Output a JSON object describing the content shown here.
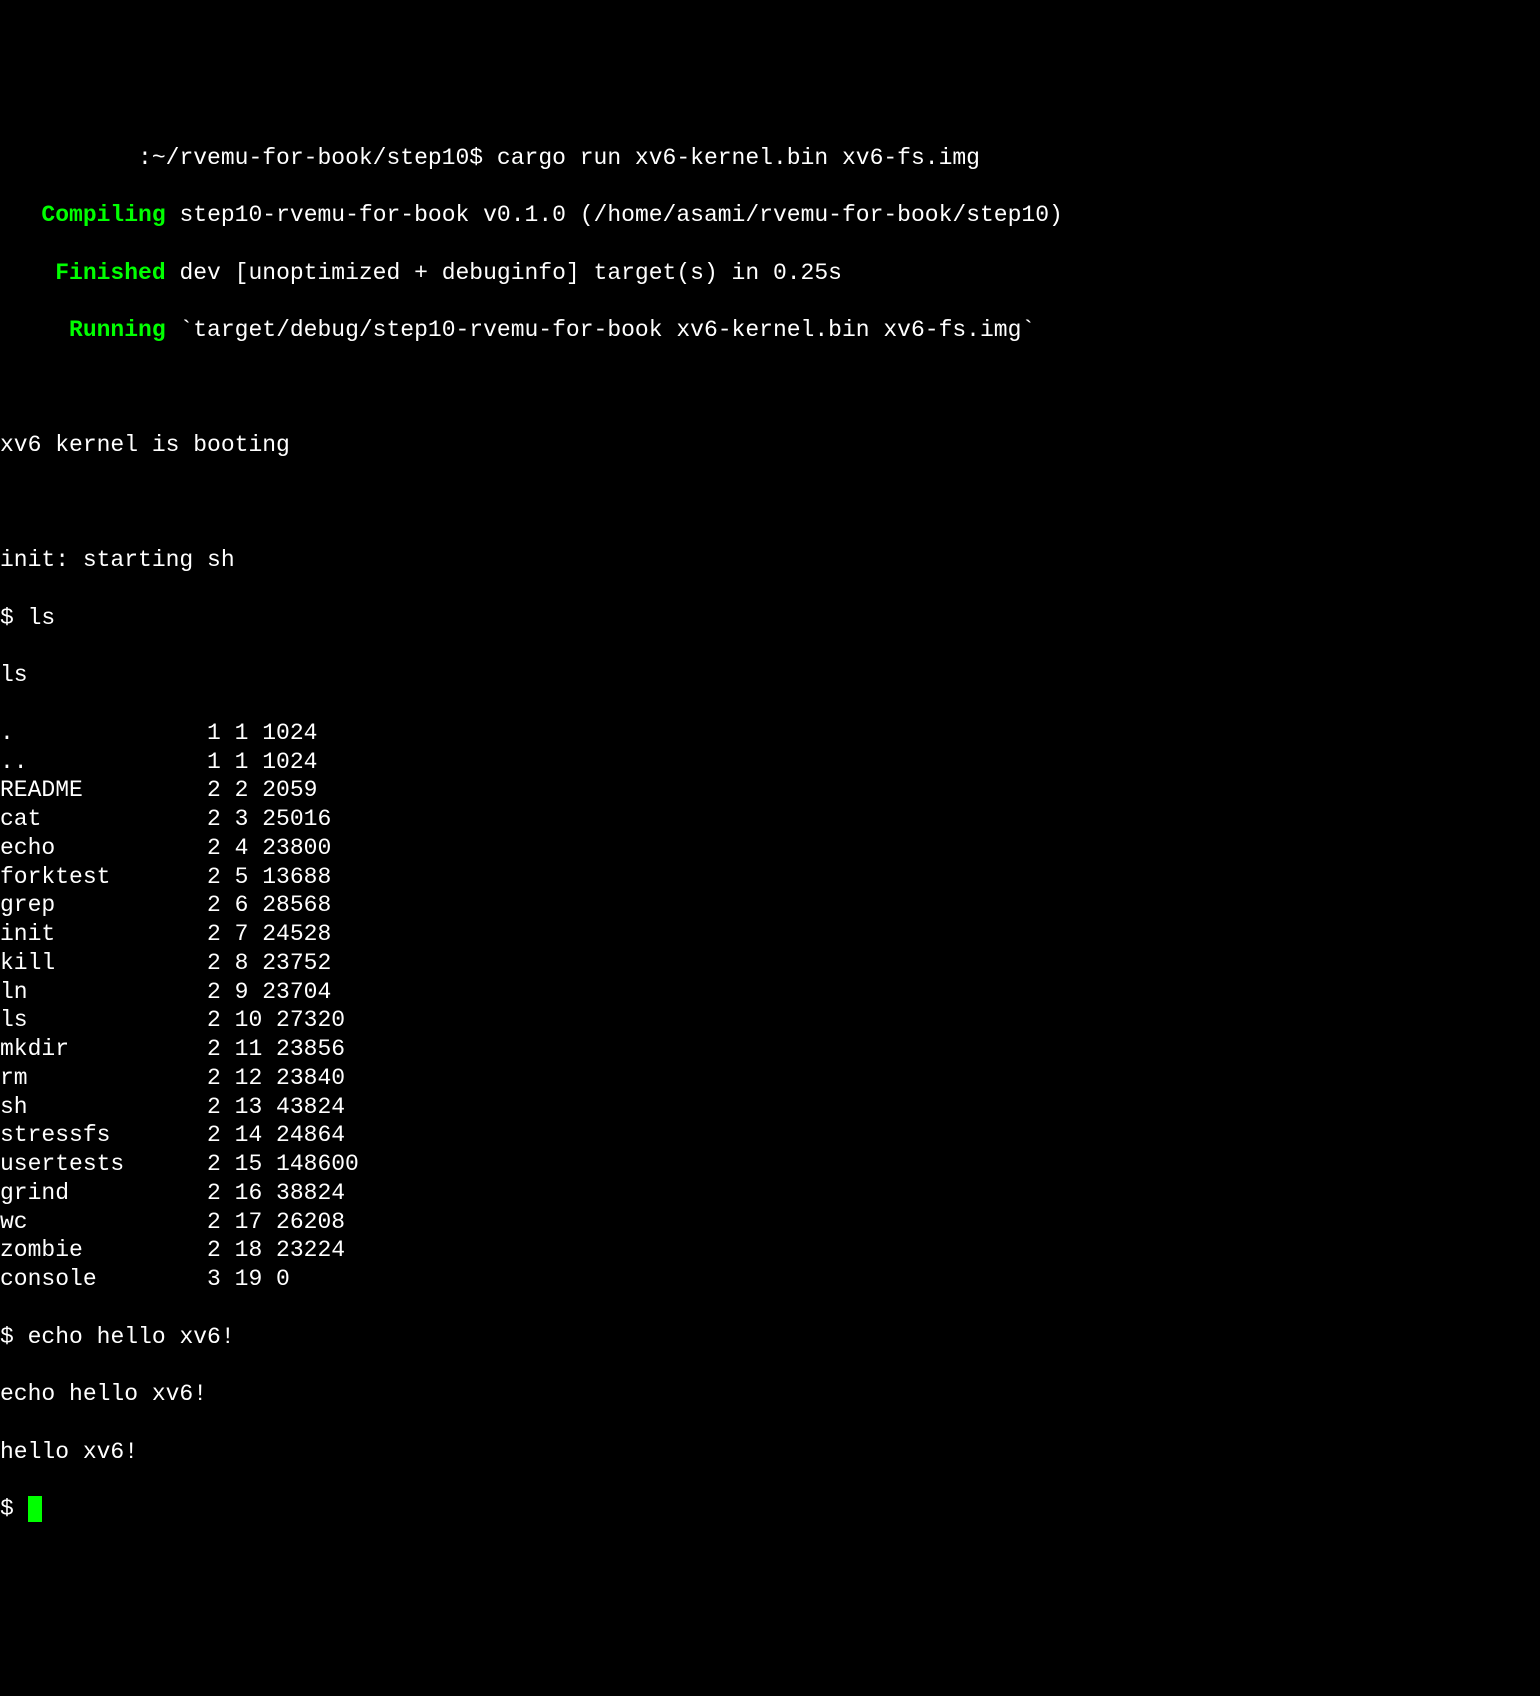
{
  "prompt_path": ":~/rvemu-for-book/step10$",
  "prompt_command": "cargo run xv6-kernel.bin xv6-fs.img",
  "compiling_label": "Compiling",
  "compiling_text": "step10-rvemu-for-book v0.1.0 (/home/asami/rvemu-for-book/step10)",
  "finished_label": "Finished",
  "finished_text": "dev [unoptimized + debuginfo] target(s) in 0.25s",
  "running_label": "Running",
  "running_text": "`target/debug/step10-rvemu-for-book xv6-kernel.bin xv6-fs.img`",
  "boot_message": "xv6 kernel is booting",
  "init_message": "init: starting sh",
  "shell_prompt": "$",
  "ls_command": "ls",
  "ls_echo": "ls",
  "files": [
    {
      "name": ".",
      "type": "1",
      "inode": "1",
      "size": "1024"
    },
    {
      "name": "..",
      "type": "1",
      "inode": "1",
      "size": "1024"
    },
    {
      "name": "README",
      "type": "2",
      "inode": "2",
      "size": "2059"
    },
    {
      "name": "cat",
      "type": "2",
      "inode": "3",
      "size": "25016"
    },
    {
      "name": "echo",
      "type": "2",
      "inode": "4",
      "size": "23800"
    },
    {
      "name": "forktest",
      "type": "2",
      "inode": "5",
      "size": "13688"
    },
    {
      "name": "grep",
      "type": "2",
      "inode": "6",
      "size": "28568"
    },
    {
      "name": "init",
      "type": "2",
      "inode": "7",
      "size": "24528"
    },
    {
      "name": "kill",
      "type": "2",
      "inode": "8",
      "size": "23752"
    },
    {
      "name": "ln",
      "type": "2",
      "inode": "9",
      "size": "23704"
    },
    {
      "name": "ls",
      "type": "2",
      "inode": "10",
      "size": "27320"
    },
    {
      "name": "mkdir",
      "type": "2",
      "inode": "11",
      "size": "23856"
    },
    {
      "name": "rm",
      "type": "2",
      "inode": "12",
      "size": "23840"
    },
    {
      "name": "sh",
      "type": "2",
      "inode": "13",
      "size": "43824"
    },
    {
      "name": "stressfs",
      "type": "2",
      "inode": "14",
      "size": "24864"
    },
    {
      "name": "usertests",
      "type": "2",
      "inode": "15",
      "size": "148600"
    },
    {
      "name": "grind",
      "type": "2",
      "inode": "16",
      "size": "38824"
    },
    {
      "name": "wc",
      "type": "2",
      "inode": "17",
      "size": "26208"
    },
    {
      "name": "zombie",
      "type": "2",
      "inode": "18",
      "size": "23224"
    },
    {
      "name": "console",
      "type": "3",
      "inode": "19",
      "size": "0"
    }
  ],
  "echo_command": "echo hello xv6!",
  "echo_echo": "echo hello xv6!",
  "echo_output": "hello xv6!"
}
